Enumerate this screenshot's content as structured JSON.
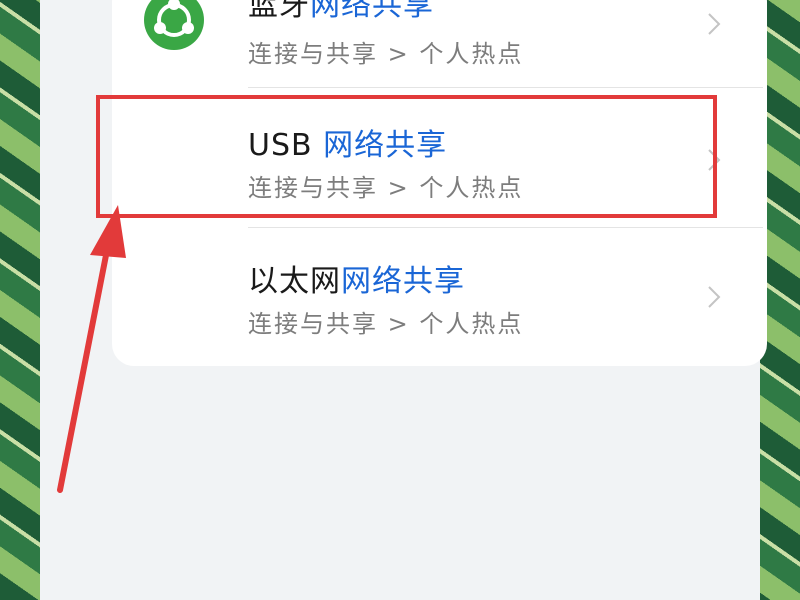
{
  "colors": {
    "accent": "#1a66d6",
    "highlight": "#e23a3a",
    "app_icon": "#3aa745"
  },
  "rows": [
    {
      "title_plain": "蓝牙",
      "title_highlight": "网络共享",
      "subtitle": "连接与共享 > 个人热点",
      "icon": "share-icon"
    },
    {
      "title_plain": "USB ",
      "title_highlight": "网络共享",
      "subtitle": "连接与共享 > 个人热点",
      "icon": ""
    },
    {
      "title_plain": "以太网",
      "title_highlight": "网络共享",
      "subtitle": "连接与共享 > 个人热点",
      "icon": ""
    }
  ]
}
